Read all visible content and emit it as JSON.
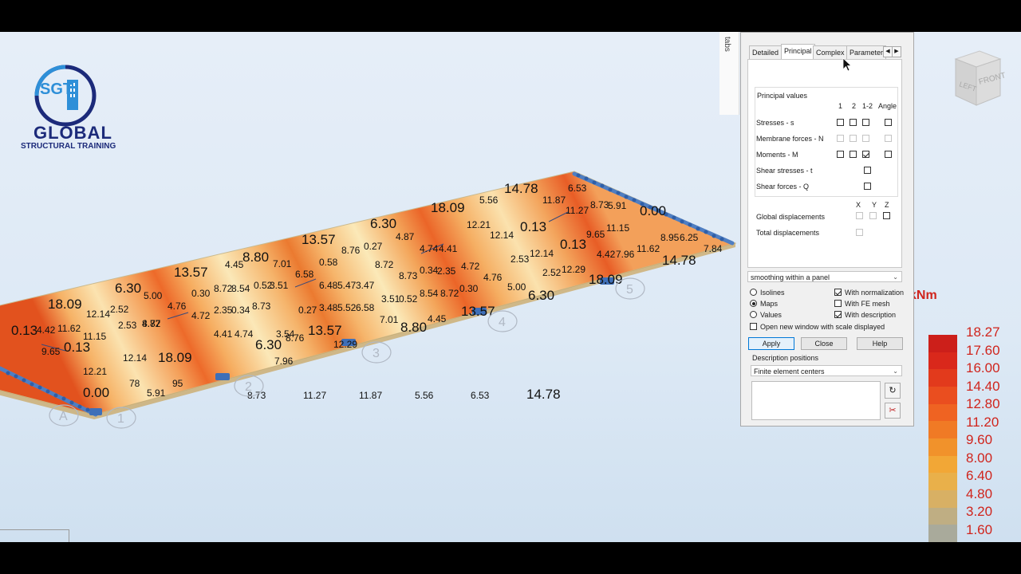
{
  "logo": {
    "badge": "SGT",
    "main": "GLOBAL",
    "sub": "STRUCTURAL TRAINING"
  },
  "navcube": {
    "left": "LEFT",
    "front": "FRONT"
  },
  "tabs_strip": {
    "label": "tabs"
  },
  "dialog": {
    "tabs": [
      {
        "label": "Detailed"
      },
      {
        "label": "Principal"
      },
      {
        "label": "Complex"
      },
      {
        "label": "Parameter"
      }
    ],
    "active_tab": "Principal",
    "principal_values_title": "Principal values",
    "col_headers": {
      "c1": "1",
      "c2": "2",
      "c12": "1-2",
      "angle": "Angle"
    },
    "rows": [
      {
        "label": "Stresses - s"
      },
      {
        "label": "Membrane forces - N"
      },
      {
        "label": "Moments - M"
      },
      {
        "label": "Shear stresses - t"
      },
      {
        "label": "Shear forces - Q"
      }
    ],
    "xyz": {
      "x": "X",
      "y": "Y",
      "z": "Z"
    },
    "global_displacements": "Global displacements",
    "total_displacements": "Total displacements",
    "smoothing": "smoothing within a panel",
    "radios": {
      "isolines": "Isolines",
      "maps": "Maps",
      "values": "Values"
    },
    "selected_radio": "Maps",
    "checks": {
      "normalization": "With normalization",
      "fe_mesh": "With FE mesh",
      "description": "With description",
      "new_window": "Open new window with scale displayed"
    },
    "buttons": {
      "apply": "Apply",
      "close": "Close",
      "help": "Help"
    },
    "desc_positions_label": "Description positions",
    "desc_positions_value": "Finite element centers"
  },
  "legend": {
    "unit": "kNm",
    "values": [
      "18.27",
      "17.60",
      "16.00",
      "14.40",
      "12.80",
      "11.20",
      "9.60",
      "8.00",
      "6.40",
      "4.80",
      "3.20",
      "1.60"
    ],
    "colors": [
      "#cc1f1a",
      "#d9281b",
      "#e23a1c",
      "#ea4e1f",
      "#ef6322",
      "#f07a25",
      "#f1922b",
      "#f2a736",
      "#e9b04a",
      "#d8b064",
      "#bfae83",
      "#a9aa9b"
    ]
  },
  "grid_axes": [
    {
      "label": "A"
    },
    {
      "label": "1"
    },
    {
      "label": "2"
    },
    {
      "label": "3"
    },
    {
      "label": "4"
    },
    {
      "label": "5"
    }
  ],
  "plate_values": [
    {
      "t": "14.78",
      "big": true
    },
    {
      "t": "6.53"
    },
    {
      "t": "11.87"
    },
    {
      "t": "11.27"
    },
    {
      "t": "8.73"
    },
    {
      "t": "5.91"
    },
    {
      "t": "0.00",
      "big": true
    },
    {
      "t": "18.09",
      "big": true
    },
    {
      "t": "5.56"
    },
    {
      "t": "12.21"
    },
    {
      "t": "12.14"
    },
    {
      "t": "0.13",
      "big": true
    },
    {
      "t": "9.65"
    },
    {
      "t": "11.15"
    },
    {
      "t": "0.13",
      "big": true
    },
    {
      "t": "8.95"
    },
    {
      "t": "6.25"
    },
    {
      "t": "4.42"
    },
    {
      "t": "7.96"
    },
    {
      "t": "11.62"
    },
    {
      "t": "14.78",
      "big": true
    },
    {
      "t": "7.84"
    },
    {
      "t": "6.30",
      "big": true
    },
    {
      "t": "4.87"
    },
    {
      "t": "4.74"
    },
    {
      "t": "4.41"
    },
    {
      "t": "4.72"
    },
    {
      "t": "2.53"
    },
    {
      "t": "12.14"
    },
    {
      "t": "12.29"
    },
    {
      "t": "18.09",
      "big": true
    },
    {
      "t": "13.57",
      "big": true
    },
    {
      "t": "0.27"
    },
    {
      "t": "8.76"
    },
    {
      "t": "8.72"
    },
    {
      "t": "0.34"
    },
    {
      "t": "2.35"
    },
    {
      "t": "4.76"
    },
    {
      "t": "2.52"
    },
    {
      "t": "8.80",
      "big": true
    },
    {
      "t": "7.01"
    },
    {
      "t": "0.58"
    },
    {
      "t": "8.73"
    },
    {
      "t": "6.58"
    },
    {
      "t": "6.48"
    },
    {
      "t": "5.47"
    },
    {
      "t": "3.47"
    },
    {
      "t": "0.30"
    },
    {
      "t": "5.00"
    },
    {
      "t": "6.30",
      "big": true
    },
    {
      "t": "13.57",
      "big": true
    },
    {
      "t": "4.45"
    },
    {
      "t": "8.72"
    },
    {
      "t": "8.54"
    },
    {
      "t": "0.52"
    },
    {
      "t": "3.51"
    },
    {
      "t": "3.51"
    },
    {
      "t": "0.52"
    },
    {
      "t": "8.54"
    },
    {
      "t": "8.72"
    },
    {
      "t": "13.57",
      "big": true
    },
    {
      "t": "6.30",
      "big": true
    },
    {
      "t": "5.00"
    },
    {
      "t": "0.30"
    },
    {
      "t": "4.76"
    },
    {
      "t": "2.35"
    },
    {
      "t": "0.34"
    },
    {
      "t": "8.73"
    },
    {
      "t": "3.48"
    },
    {
      "t": "5.52"
    },
    {
      "t": "6.58"
    },
    {
      "t": "7.01"
    },
    {
      "t": "4.45"
    },
    {
      "t": "8.80",
      "big": true
    },
    {
      "t": "18.09",
      "big": true
    },
    {
      "t": "2.52"
    },
    {
      "t": "4.72"
    },
    {
      "t": "4.41"
    },
    {
      "t": "4.74"
    },
    {
      "t": "8.72"
    },
    {
      "t": "3.54"
    },
    {
      "t": "0.27"
    },
    {
      "t": "8.76"
    },
    {
      "t": "13.57",
      "big": true
    },
    {
      "t": "12.29"
    },
    {
      "t": "12.14"
    },
    {
      "t": "2.53"
    },
    {
      "t": "4.87"
    },
    {
      "t": "6.30",
      "big": true
    },
    {
      "t": "7.96"
    },
    {
      "t": "4.42"
    },
    {
      "t": "11.62"
    },
    {
      "t": "0.13",
      "big": true
    },
    {
      "t": "11.15"
    },
    {
      "t": "9.65"
    },
    {
      "t": "0.13",
      "big": true
    },
    {
      "t": "12.14"
    },
    {
      "t": "12.21"
    },
    {
      "t": "18.09",
      "big": true
    },
    {
      "t": "95"
    },
    {
      "t": "78"
    },
    {
      "t": "0.00",
      "big": true
    },
    {
      "t": "5.91"
    },
    {
      "t": "8.73"
    },
    {
      "t": "11.27"
    },
    {
      "t": "11.87"
    },
    {
      "t": "5.56"
    },
    {
      "t": "6.53"
    },
    {
      "t": "14.78",
      "big": true
    }
  ]
}
